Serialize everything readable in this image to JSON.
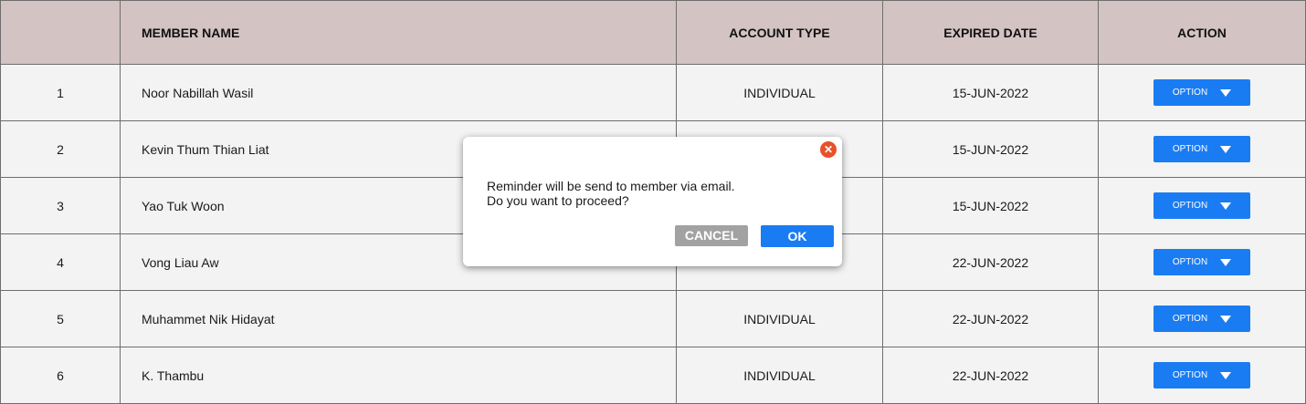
{
  "table": {
    "headers": {
      "number": "",
      "member_name": "MEMBER NAME",
      "account_type": "ACCOUNT TYPE",
      "expired_date": "EXPIRED DATE",
      "action": "ACTION"
    },
    "rows": [
      {
        "no": "1",
        "name": "Noor Nabillah Wasil",
        "type": "INDIVIDUAL",
        "date": "15-JUN-2022",
        "action": "OPTION"
      },
      {
        "no": "2",
        "name": "Kevin Thum Thian Liat",
        "type": "",
        "date": "15-JUN-2022",
        "action": "OPTION"
      },
      {
        "no": "3",
        "name": "Yao Tuk Woon",
        "type": "",
        "date": "15-JUN-2022",
        "action": "OPTION"
      },
      {
        "no": "4",
        "name": "Vong Liau Aw",
        "type": "",
        "date": "22-JUN-2022",
        "action": "OPTION"
      },
      {
        "no": "5",
        "name": "Muhammet Nik Hidayat",
        "type": "INDIVIDUAL",
        "date": "22-JUN-2022",
        "action": "OPTION"
      },
      {
        "no": "6",
        "name": "K. Thambu",
        "type": "INDIVIDUAL",
        "date": "22-JUN-2022",
        "action": "OPTION"
      }
    ]
  },
  "dialog": {
    "message_line1": "Reminder will be send to member via email.",
    "message_line2": "Do you want to proceed?",
    "cancel_label": "CANCEL",
    "ok_label": "OK",
    "close_icon": "close-icon"
  },
  "colors": {
    "header_bg": "#d4c3c3",
    "row_bg": "#f3f3f3",
    "accent_blue": "#1a7cf2",
    "close_red": "#e8512a",
    "cancel_gray": "#a2a2a2"
  }
}
